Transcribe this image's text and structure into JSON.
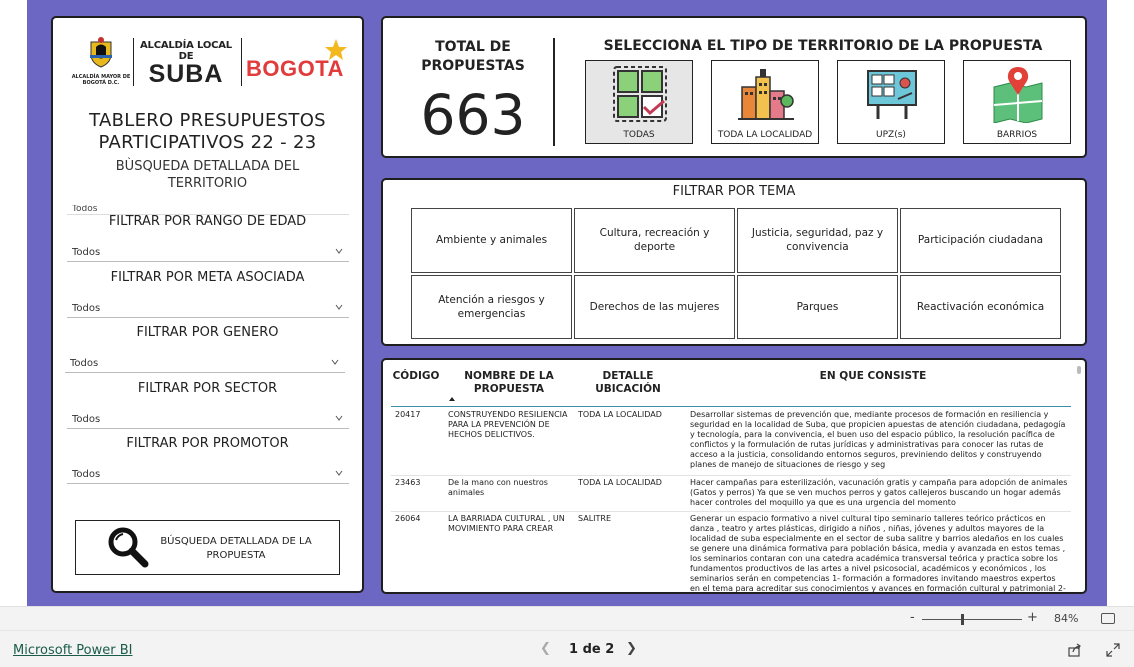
{
  "logos": {
    "escudo_caption": "ALCALDÍA MAYOR DE BOGOTÁ D.C.",
    "alcaldia_local_small": "ALCALDÍA LOCAL DE",
    "alcaldia_local_big": "SUBA",
    "bogota": "BOGOTA"
  },
  "left_panel": {
    "title_line1": "TABLERO PRESUPUESTOS",
    "title_line2": "PARTICIPATIVOS 22 - 23",
    "subtitle_line1": "BÙSQUEDA DETALLADA DEL",
    "subtitle_line2": "TERRITORIO",
    "truncated_dropdown_value": "Todos",
    "filters": [
      {
        "label": "FILTRAR POR RANGO DE EDAD",
        "value": "Todos"
      },
      {
        "label": "FILTRAR POR META ASOCIADA",
        "value": "Todos"
      },
      {
        "label": "FILTRAR POR GENERO",
        "value": "Todos"
      },
      {
        "label": "FILTRAR POR SECTOR",
        "value": "Todos"
      },
      {
        "label": "FILTRAR POR PROMOTOR",
        "value": "Todos"
      }
    ],
    "search_button": "BÚSQUEDA DETALLADA DE LA PROPUESTA"
  },
  "total": {
    "label_line1": "TOTAL DE",
    "label_line2": "PROPUESTAS",
    "value": "663"
  },
  "territorio": {
    "title": "SELECCIONA EL TIPO DE TERRITORIO DE LA PROPUESTA",
    "options": [
      {
        "label": "TODAS",
        "icon": "grid-check-icon",
        "selected": true
      },
      {
        "label": "TODA LA LOCALIDAD",
        "icon": "city-buildings-icon",
        "selected": false
      },
      {
        "label": "UPZ(s)",
        "icon": "map-board-icon",
        "selected": false
      },
      {
        "label": "BARRIOS",
        "icon": "map-pin-icon",
        "selected": false
      }
    ]
  },
  "tema": {
    "title": "FILTRAR POR TEMA",
    "items": [
      "Ambiente y animales",
      "Cultura, recreación y deporte",
      "Justicia, seguridad, paz y convivencia",
      "Participación ciudadana",
      "Atención a riesgos y emergencias",
      "Derechos de las mujeres",
      "Parques",
      "Reactivación económica"
    ]
  },
  "table": {
    "headers": {
      "code": "CÓDIGO",
      "name": "NOMBRE DE LA PROPUESTA",
      "detail": "DETALLE UBICACIÓN",
      "description": "EN QUE CONSISTE"
    },
    "rows": [
      {
        "code": "20417",
        "name": "CONSTRUYENDO RESILIENCIA PARA LA PREVENCIÓN DE HECHOS DELICTIVOS.",
        "detail": "TODA LA LOCALIDAD",
        "description": "Desarrollar sistemas de prevención que, mediante procesos de formación en resiliencia y seguridad en la localidad de Suba, que propicien apuestas de atención ciudadana, pedagogía y tecnología, para la convivencia, el buen uso del espacio público, la resolución pacífica de conflictos y la formulación de rutas jurídicas y administrativas para conocer las rutas de acceso a la justicia, consolidando entornos seguros, previniendo delitos y construyendo planes de manejo de situaciones de riesgo y seg"
      },
      {
        "code": "23463",
        "name": "De la mano con nuestros animales",
        "detail": "TODA LA LOCALIDAD",
        "description": "Hacer campañas para esterilización, vacunación gratis y campaña para adopción de animales (Gatos y perros) Ya que se ven muchos perros y gatos callejeros buscando un hogar además hacer controles del moquillo ya que es una urgencia del momento"
      },
      {
        "code": "26064",
        "name": "LA BARRIADA CULTURAL , UN MOVIMIENTO PARA CREAR",
        "detail": "SALITRE",
        "description": "Generar un espacio formativo a nivel cultural tipo seminario talleres teórico prácticos en danza , teatro y artes plásticas, dirigido a niños , niñas, jóvenes y adultos mayores de la localidad de suba especialmente en el sector de suba salitre y barrios aledaños en los cuales se genere una dinámica formativa para población básica, media y avanzada en estos temas , los seminarios contaran con una catedra académica transversal teórica y practica sobre los fundamentos productivos de las artes a nivel psicosocial, académicos y económicos , los seminarios serán en competencias 1- formación a formadores invitando maestros expertos en el tema para acreditar sus conocimientos y avances en formación cultural y patrimonial 2-"
      }
    ]
  },
  "zoom": {
    "minus": "-",
    "plus": "+",
    "percent": "84%",
    "level": 0.4
  },
  "footer": {
    "app_link": "Microsoft Power BI",
    "page_indicator": "1 de 2"
  },
  "colors": {
    "report_background": "#6b67c3",
    "bogota_red": "#e23b3b",
    "header_line": "#3d8fa8"
  }
}
